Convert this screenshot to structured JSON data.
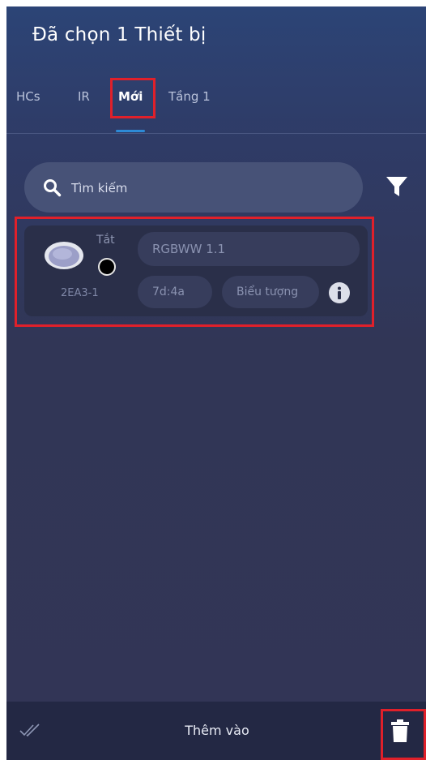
{
  "header": {
    "title": "Đã chọn 1 Thiết bị"
  },
  "tabs": [
    {
      "label": "HCs"
    },
    {
      "label": "IR"
    },
    {
      "label": "Mới",
      "active": true
    },
    {
      "label": "Tầng 1"
    }
  ],
  "search": {
    "placeholder": "Tìm kiếm",
    "icon": "search-icon"
  },
  "filter": {
    "icon": "filter-icon"
  },
  "device": {
    "status": "Tắt",
    "id": "2EA3-1",
    "name": "RGBWW 1.1",
    "mac": "7d:4a",
    "icon_label": "Biểu tượng",
    "icon": "ceiling-light-icon"
  },
  "bottom_bar": {
    "add_label": "Thêm vào",
    "check_icon": "double-check-icon",
    "delete_icon": "trash-icon"
  },
  "colors": {
    "accent": "#2d8ad6",
    "highlight": "#e0202a",
    "background": "#323556"
  }
}
